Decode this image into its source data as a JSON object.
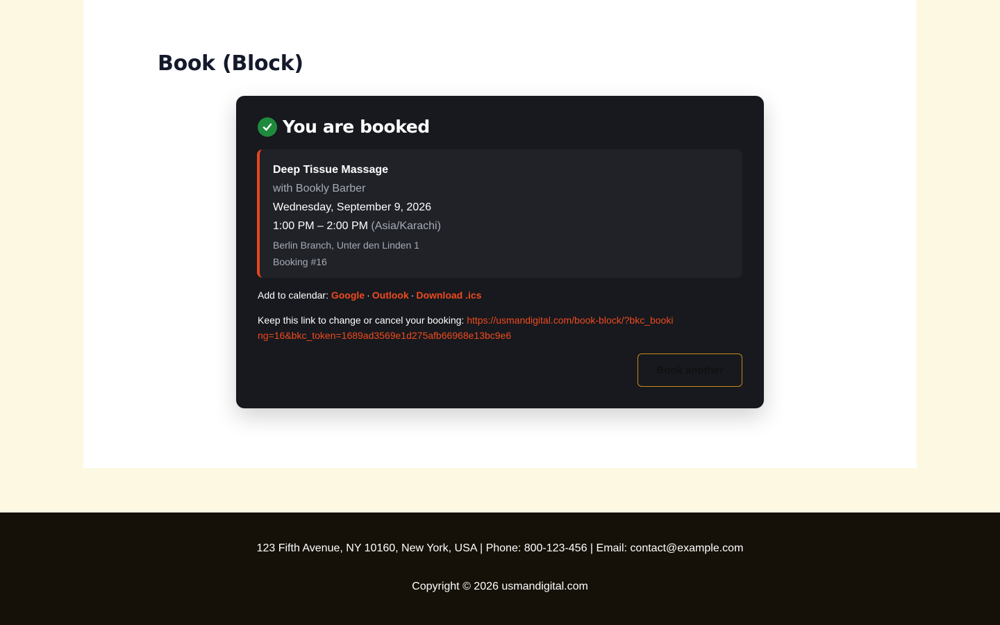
{
  "page": {
    "title": "Book (Block)"
  },
  "confirmation": {
    "title": "You are booked",
    "service": "Deep Tissue Massage",
    "staff": "with Bookly Barber",
    "date": "Wednesday, September 9, 2026",
    "time": "1:00 PM – 2:00 PM",
    "timezone": "(Asia/Karachi)",
    "location": "Berlin Branch, Unter den Linden 1",
    "booking_number": "Booking #16"
  },
  "calendar": {
    "label": "Add to calendar:",
    "google": "Google",
    "outlook": "Outlook",
    "ics": "Download .ics",
    "separator": "·"
  },
  "manage": {
    "label": "Keep this link to change or cancel your booking:",
    "url": "https://usmandigital.com/book-block/?bkc_booking=16&bkc_token=1689ad3569e1d275afb66968e13bc9e6"
  },
  "actions": {
    "book_another": "Book another"
  },
  "footer": {
    "address": "123 Fifth Avenue, NY 10160, New York, USA | Phone: 800-123-456 | Email: contact@example.com",
    "copyright": "Copyright © 2026 usmandigital.com"
  },
  "colors": {
    "accent": "#f04a1e",
    "success": "#1f8a3c",
    "card_bg": "#17191e",
    "footer_bg": "#151108",
    "page_bg": "#fdf8e2"
  }
}
